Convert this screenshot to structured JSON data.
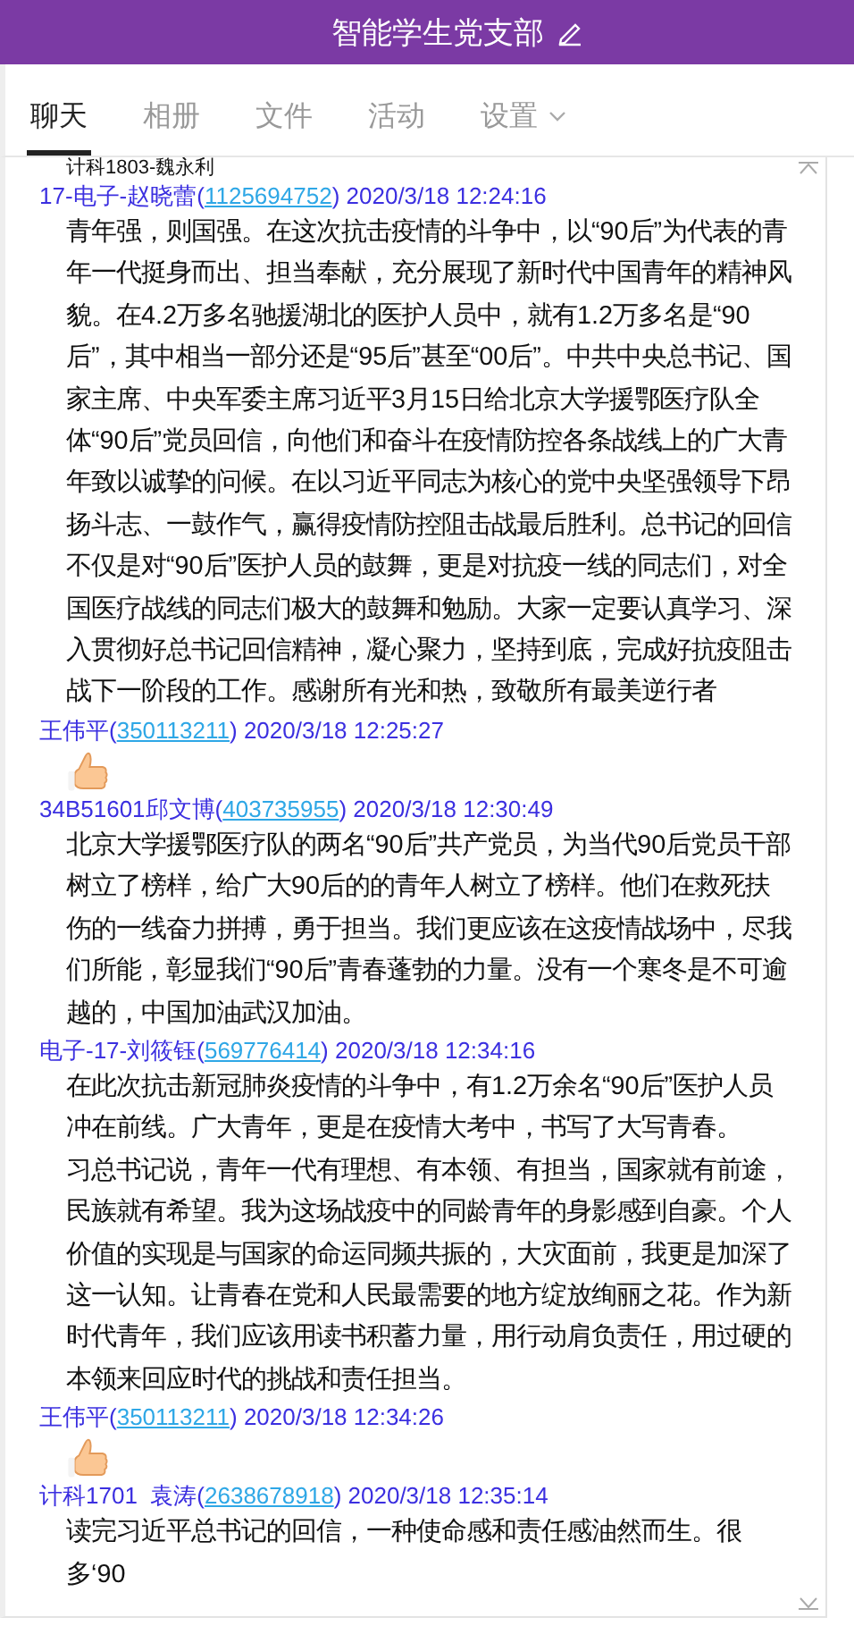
{
  "header": {
    "title": "智能学生党支部"
  },
  "tabs": [
    {
      "label": "聊天",
      "selected": true
    },
    {
      "label": "相册",
      "selected": false
    },
    {
      "label": "文件",
      "selected": false
    },
    {
      "label": "活动",
      "selected": false
    },
    {
      "label": "设置",
      "selected": false,
      "dropdown": true
    }
  ],
  "chat": {
    "cut_top_line": "计科1803-魏永利",
    "messages": [
      {
        "sender": "17-电子-赵晓蕾",
        "qq": "(1125694752)",
        "time": "2020/3/18 12:24:16",
        "kind": "text",
        "paragraphs": [
          "青年强，则国强。在这次抗击疫情的斗争中，以“90后”为代表的青年一代挺身而出、担当奉献，充分展现了新时代中国青年的精神风貌。在4.2万多名驰援湖北的医护人员中，就有1.2万多名是“90后”，其中相当一部分还是“95后”甚至“00后”。中共中央总书记、国家主席、中央军委主席习近平3月15日给北京大学援鄂医疗队全体“90后”党员回信，向他们和奋斗在疫情防控各条战线上的广大青年致以诚挚的问候。在以习近平同志为核心的党中央坚强领导下昂扬斗志、一鼓作气，赢得疫情防控阻击战最后胜利。总书记的回信不仅是对“90后”医护人员的鼓舞，更是对抗疫一线的同志们，对全国医疗战线的同志们极大的鼓舞和勉励。大家一定要认真学习、深入贯彻好总书记回信精神，凝心聚力，坚持到底，完成好抗疫阻击战下一阶段的工作。感谢所有光和热，致敬所有最美逆行者"
        ]
      },
      {
        "sender": "王伟平",
        "qq": "(350113211)",
        "time": "2020/3/18 12:25:27",
        "kind": "thumbs-up"
      },
      {
        "sender": "34B51601邱文博",
        "qq": "(403735955)",
        "time": "2020/3/18 12:30:49",
        "kind": "text",
        "paragraphs": [
          "北京大学援鄂医疗队的两名“90后”共产党员，为当代90后党员干部树立了榜样，给广大90后的的青年人树立了榜样。他们在救死扶伤的一线奋力拼搏，勇于担当。我们更应该在这疫情战场中，尽我们所能，彰显我们“90后”青春蓬勃的力量。没有一个寒冬是不可逾越的，中国加油武汉加油。"
        ]
      },
      {
        "sender": "电子-17-刘筱钰",
        "qq": "(569776414)",
        "time": "2020/3/18 12:34:16",
        "kind": "text",
        "paragraphs": [
          "在此次抗击新冠肺炎疫情的斗争中，有1.2万余名“90后”医护人员冲在前线。广大青年，更是在疫情大考中，书写了大写青春。",
          "习总书记说，青年一代有理想、有本领、有担当，国家就有前途，民族就有希望。我为这场战疫中的同龄青年的身影感到自豪。个人价值的实现是与国家的命运同频共振的，大灾面前，我更是加深了这一认知。让青春在党和人民最需要的地方绽放绚丽之花。作为新时代青年，我们应该用读书积蓄力量，用行动肩负责任，用过硬的本领来回应时代的挑战和责任担当。"
        ]
      },
      {
        "sender": "王伟平",
        "qq": "(350113211)",
        "time": "2020/3/18 12:34:26",
        "kind": "thumbs-up"
      },
      {
        "sender": "计科1701  袁涛",
        "qq": "(2638678918)",
        "time": "2020/3/18 12:35:14",
        "kind": "text",
        "paragraphs": [
          "读完习近平总书记的回信，一种使命感和责任感油然而生。很多‘90"
        ]
      }
    ]
  }
}
